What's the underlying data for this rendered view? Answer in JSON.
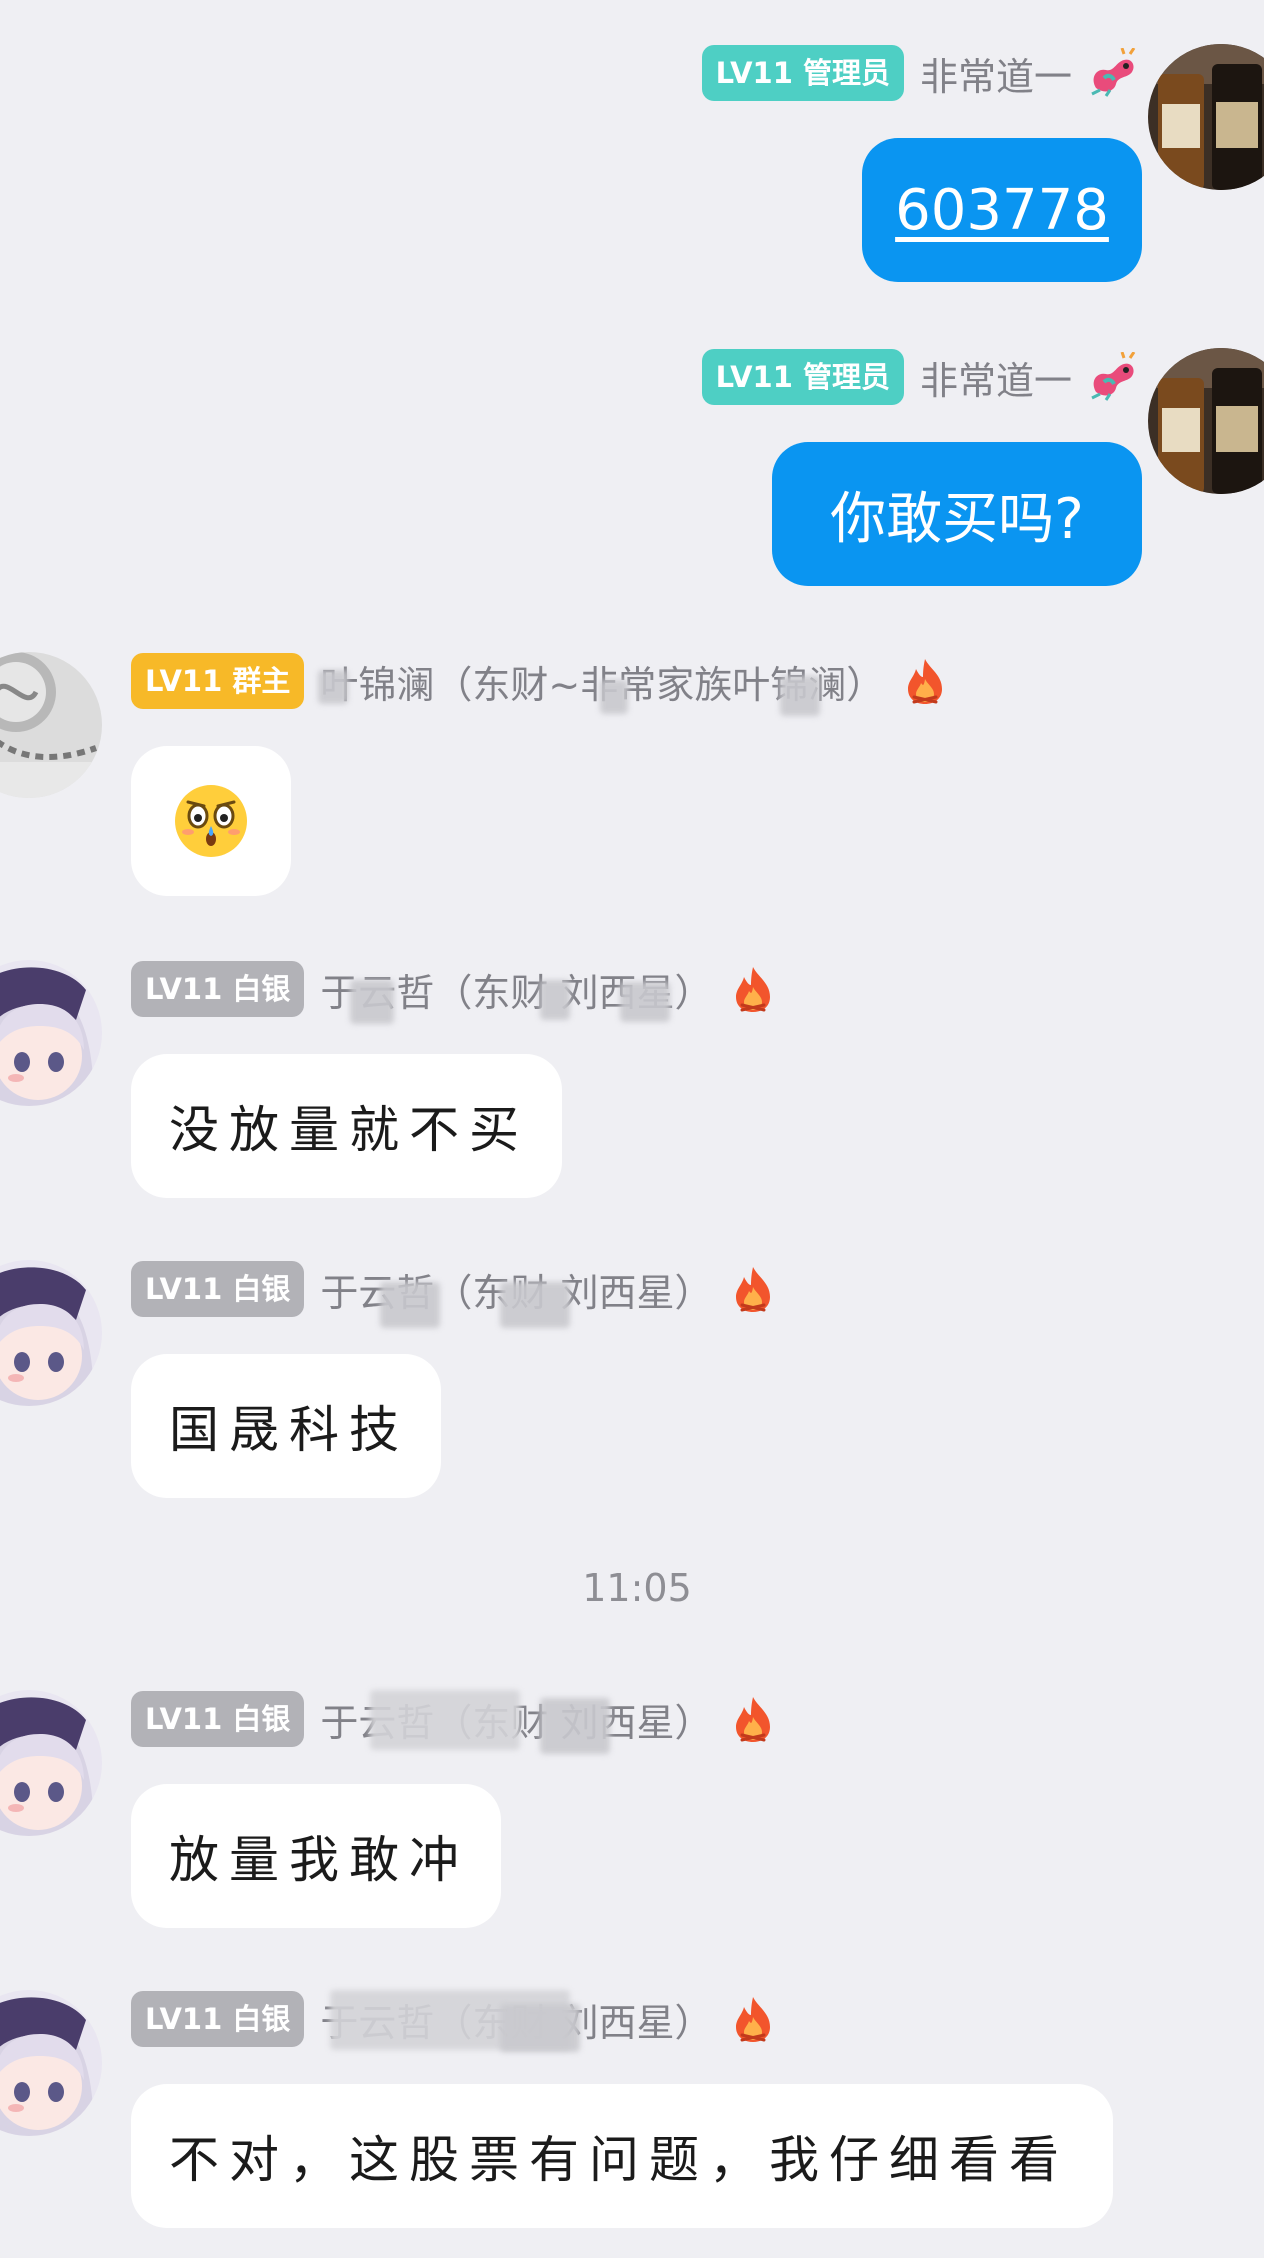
{
  "colors": {
    "background": "#efeff3",
    "my_bubble": "#0a95f1",
    "other_bubble": "#ffffff",
    "badge_admin": "#4ecfc4",
    "badge_owner": "#f7b928",
    "badge_silver": "#b2b2b7"
  },
  "messages": [
    {
      "badge": "LV11 管理员",
      "sender": "非常道一",
      "text": "603778",
      "icons": [
        "dragon-decoration-icon",
        "whisky-bottles-avatar"
      ]
    },
    {
      "badge": "LV11 管理员",
      "sender": "非常道一",
      "text": "你敢买吗?",
      "icons": [
        "dragon-decoration-icon",
        "whisky-bottles-avatar"
      ]
    },
    {
      "badge": "LV11 群主",
      "sender": "叶锦澜（东财~非常家族叶锦澜）",
      "text": "",
      "icons": [
        "shocked-face-emoji",
        "flame-icon",
        "silver-pendant-avatar"
      ]
    },
    {
      "badge": "LV11 白银",
      "sender": "于云哲（东财 刘西星）",
      "text": "没放量就不买",
      "icons": [
        "flame-icon",
        "anime-girl-avatar"
      ]
    },
    {
      "badge": "LV11 白银",
      "sender": "于云哲（东财 刘西星）",
      "text": "国晟科技",
      "icons": [
        "flame-icon",
        "anime-girl-avatar"
      ]
    },
    {
      "badge": "LV11 白银",
      "sender": "于云哲（东财 刘西星）",
      "text": "放量我敢冲",
      "icons": [
        "flame-icon",
        "anime-girl-avatar"
      ]
    },
    {
      "badge": "LV11 白银",
      "sender": "于云哲（东财 刘西星）",
      "text": "不对，这股票有问题，我仔细看看",
      "icons": [
        "flame-icon",
        "anime-girl-avatar"
      ]
    }
  ],
  "timestamp": "11:05"
}
